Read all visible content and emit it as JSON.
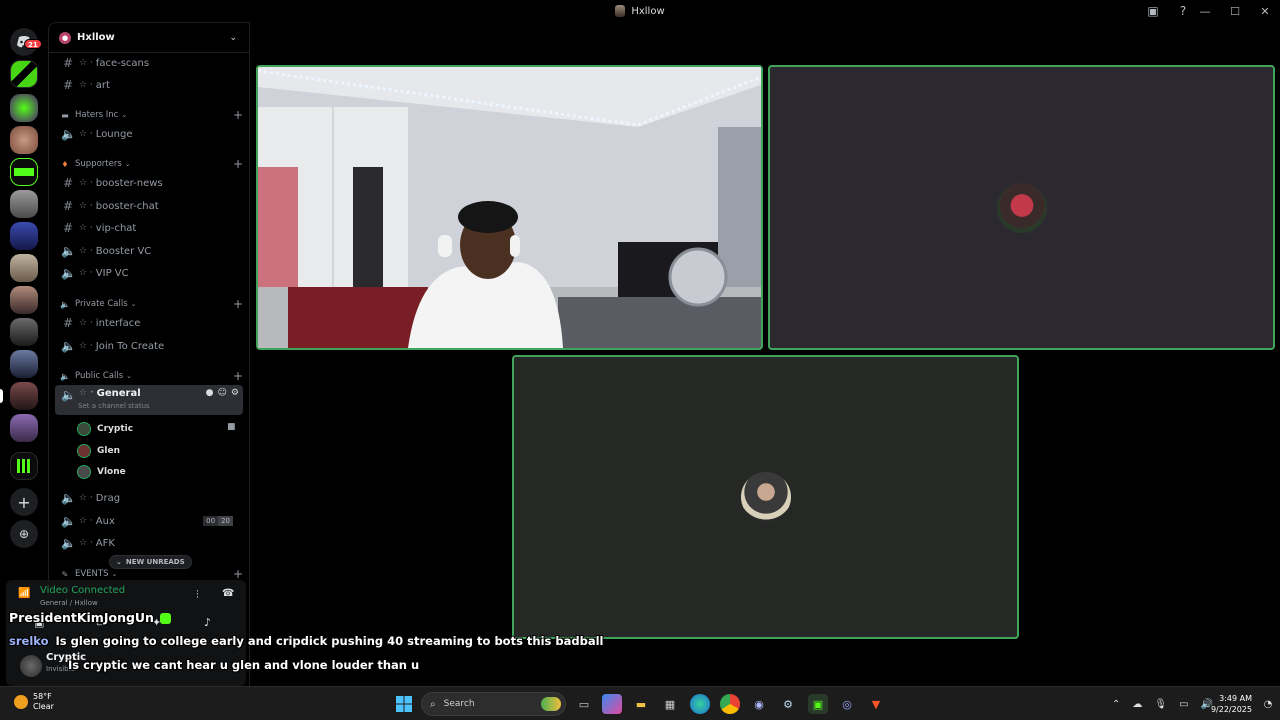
{
  "window": {
    "title": "Hxllow",
    "controls": {
      "minimize": "—",
      "maximize": "☐",
      "close": "✕"
    }
  },
  "rail": {
    "home_badge": "21",
    "add_icon": "+",
    "discover_icon": "⊕"
  },
  "guild": {
    "name": "Hxllow",
    "chevron": "⌄"
  },
  "channels": {
    "face_scans": "face-scans",
    "art": "art",
    "cat_haters": "Haters Inc",
    "lounge": "Lounge",
    "cat_supporters": "Supporters",
    "booster_news": "booster-news",
    "booster_chat": "booster-chat",
    "vip_chat": "vip-chat",
    "booster_vc": "Booster VC",
    "vip_vc": "VIP VC",
    "cat_private": "Private Calls",
    "interface": "interface",
    "join_to_create": "Join To Create",
    "cat_public": "Public Calls",
    "general": "General",
    "general_status": "Set a channel status",
    "drag": "Drag",
    "aux": "Aux",
    "aux_count": "00",
    "aux_limit": "20",
    "afk": "AFK",
    "cat_events": "EVENTS",
    "new_unreads": "NEW UNREADS"
  },
  "voice_users": [
    {
      "name": "Cryptic",
      "color": "#3a4a3a"
    },
    {
      "name": "Glen",
      "color": "#6b3030"
    },
    {
      "name": "Vlone",
      "color": "#4a4a4a"
    }
  ],
  "voice_panel": {
    "status": "Video Connected",
    "location": "General / Hxllow"
  },
  "user_panel": {
    "name": "Cryptic",
    "status": "Invisible"
  },
  "overlay": {
    "line1_user": "PresidentKimJongUn",
    "line2_user": "srelko",
    "line2_text": "Is glen going to college early and cripdick pushing 40 streaming to bots this badball",
    "line3_text": "Is cryptic we cant hear u glen and vlone louder than u"
  },
  "taskbar": {
    "temp": "58°F",
    "condition": "Clear",
    "search_placeholder": "Search",
    "time": "3:49 AM",
    "date": "9/22/2025"
  },
  "colors": {
    "speaking": "#40a55a",
    "online": "#23a55a",
    "badge": "#f23f43"
  }
}
